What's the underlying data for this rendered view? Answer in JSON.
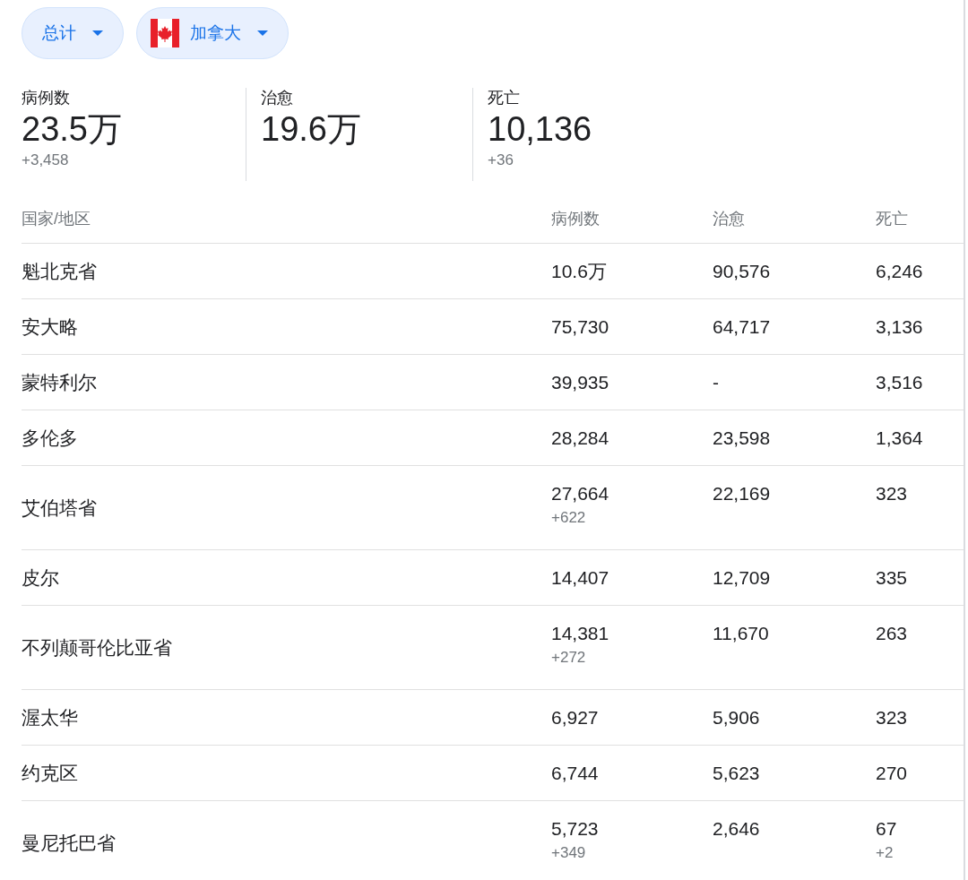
{
  "filters": [
    {
      "label": "总计",
      "flag": false
    },
    {
      "label": "加拿大",
      "flag": true
    }
  ],
  "stats": [
    {
      "label": "病例数",
      "value": "23.5万",
      "delta": "+3,458"
    },
    {
      "label": "治愈",
      "value": "19.6万"
    },
    {
      "label": "死亡",
      "value": "10,136",
      "delta": "+36"
    }
  ],
  "table": {
    "columns": [
      "国家/地区",
      "病例数",
      "治愈",
      "死亡"
    ],
    "rows": [
      {
        "cells": [
          {
            "value": "魁北克省"
          },
          {
            "value": "10.6万"
          },
          {
            "value": "90,576"
          },
          {
            "value": "6,246"
          }
        ]
      },
      {
        "cells": [
          {
            "value": "安大略"
          },
          {
            "value": "75,730"
          },
          {
            "value": "64,717"
          },
          {
            "value": "3,136"
          }
        ]
      },
      {
        "cells": [
          {
            "value": "蒙特利尔"
          },
          {
            "value": "39,935"
          },
          {
            "value": "-"
          },
          {
            "value": "3,516"
          }
        ]
      },
      {
        "cells": [
          {
            "value": "多伦多"
          },
          {
            "value": "28,284"
          },
          {
            "value": "23,598"
          },
          {
            "value": "1,364"
          }
        ]
      },
      {
        "cells": [
          {
            "value": "艾伯塔省"
          },
          {
            "value": "27,664",
            "delta": "+622"
          },
          {
            "value": "22,169"
          },
          {
            "value": "323"
          }
        ]
      },
      {
        "cells": [
          {
            "value": "皮尔"
          },
          {
            "value": "14,407"
          },
          {
            "value": "12,709"
          },
          {
            "value": "335"
          }
        ]
      },
      {
        "cells": [
          {
            "value": "不列颠哥伦比亚省"
          },
          {
            "value": "14,381",
            "delta": "+272"
          },
          {
            "value": "11,670"
          },
          {
            "value": "263"
          }
        ]
      },
      {
        "cells": [
          {
            "value": "渥太华"
          },
          {
            "value": "6,927"
          },
          {
            "value": "5,906"
          },
          {
            "value": "323"
          }
        ]
      },
      {
        "cells": [
          {
            "value": "约克区"
          },
          {
            "value": "6,744"
          },
          {
            "value": "5,623"
          },
          {
            "value": "270"
          }
        ]
      },
      {
        "cells": [
          {
            "value": "曼尼托巴省"
          },
          {
            "value": "5,723",
            "delta": "+349"
          },
          {
            "value": "2,646"
          },
          {
            "value": "67",
            "delta": "+2"
          }
        ]
      }
    ]
  }
}
